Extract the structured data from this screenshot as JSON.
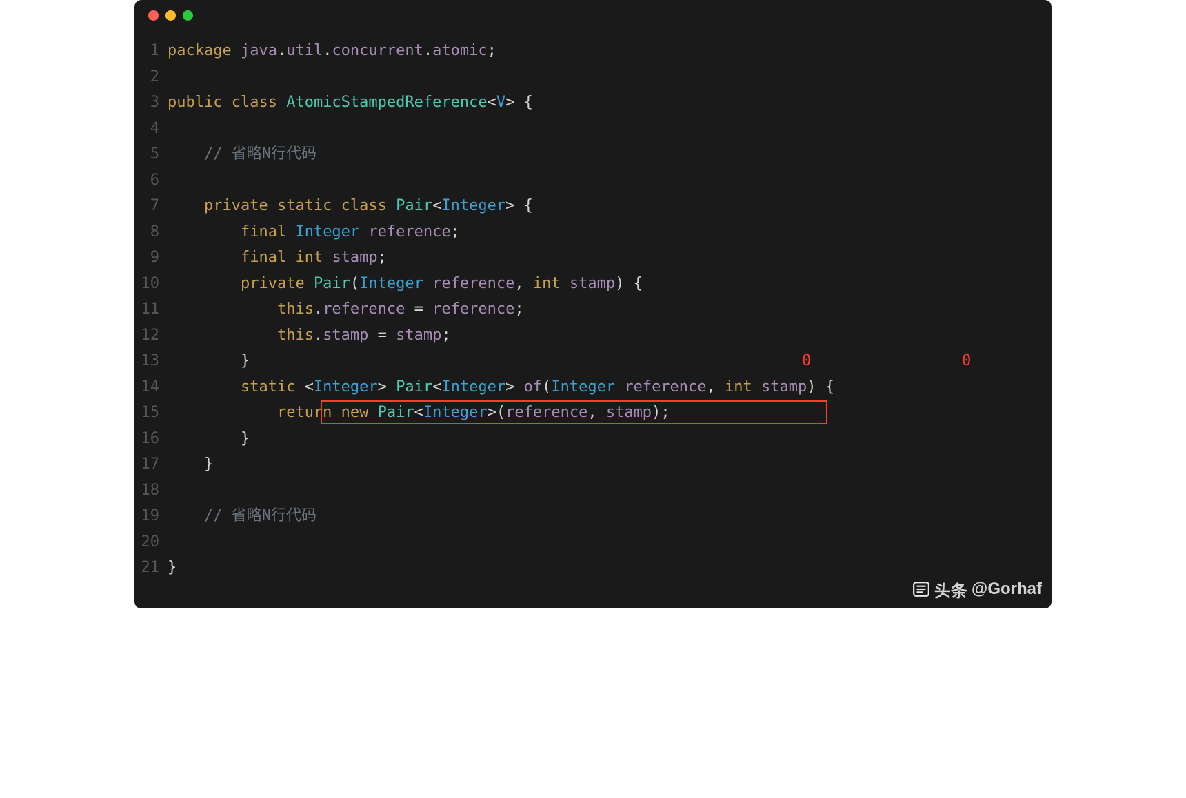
{
  "window": {
    "buttons": [
      "close",
      "minimize",
      "zoom"
    ]
  },
  "gutter": [
    "1",
    "2",
    "3",
    "4",
    "5",
    "6",
    "7",
    "8",
    "9",
    "10",
    "11",
    "12",
    "13",
    "14",
    "15",
    "16",
    "17",
    "18",
    "19",
    "20",
    "21"
  ],
  "code": {
    "l1": {
      "package_kw": "package ",
      "pkg": "java",
      "dot1": ".",
      "util": "util",
      "dot2": ".",
      "conc": "concurrent",
      "dot3": ".",
      "atomic": "atomic",
      "semi": ";"
    },
    "l3": {
      "public_kw": "public ",
      "class_kw": "class ",
      "name": "AtomicStampedReference",
      "lt": "<",
      "tp": "V",
      "gt": "> {",
      "open": ""
    },
    "l5": {
      "indent": "    ",
      "cmt": "// 省略N行代码"
    },
    "l7": {
      "indent": "    ",
      "private_kw": "private ",
      "static_kw": "static ",
      "class_kw": "class ",
      "name": "Pair",
      "lt": "<",
      "tp": "Integer",
      "gt": "> {"
    },
    "l8": {
      "indent": "        ",
      "final_kw": "final ",
      "type": "Integer ",
      "var": "reference",
      "semi": ";"
    },
    "l9": {
      "indent": "        ",
      "final_kw": "final ",
      "int_kw": "int ",
      "var": "stamp",
      "semi": ";"
    },
    "l10": {
      "indent": "        ",
      "private_kw": "private ",
      "name": "Pair",
      "lp": "(",
      "t1": "Integer ",
      "p1": "reference",
      "comma": ", ",
      "int_kw": "int ",
      "p2": "stamp",
      "rp": ") {"
    },
    "l11": {
      "indent": "            ",
      "this_kw": "this",
      "dot": ".",
      "field": "reference",
      "eq": " = ",
      "val": "reference",
      "semi": ";"
    },
    "l12": {
      "indent": "            ",
      "this_kw": "this",
      "dot": ".",
      "field": "stamp",
      "eq": " = ",
      "val": "stamp",
      "semi": ";"
    },
    "l13": {
      "indent": "        ",
      "brace": "}",
      "zero1": "0",
      "zero2": "0"
    },
    "l14": {
      "indent": "        ",
      "static_kw": "static ",
      "lt1": "<",
      "tp1": "Integer",
      "gt1": "> ",
      "ret": "Pair",
      "lt2": "<",
      "tp2": "Integer",
      "gt2": "> ",
      "fn": "of",
      "lp": "(",
      "t1": "Integer ",
      "p1": "reference",
      "comma": ", ",
      "int_kw": "int ",
      "p2": "stamp",
      "rp": ") {"
    },
    "l15": {
      "indent": "            ",
      "return_kw": "return ",
      "new_kw": "new ",
      "cls": "Pair",
      "lt": "<",
      "tp": "Integer",
      "gt": ">",
      "lp": "(",
      "a1": "reference",
      "comma": ", ",
      "a2": "stamp",
      "rp": ")",
      "semi": ";"
    },
    "l16": {
      "indent": "        ",
      "brace": "}"
    },
    "l17": {
      "indent": "    ",
      "brace": "}"
    },
    "l19": {
      "indent": "    ",
      "cmt": "// 省略N行代码"
    },
    "l21": {
      "brace": "}"
    }
  },
  "watermark": {
    "label": "头条",
    "handle": "@Gorhaf"
  }
}
